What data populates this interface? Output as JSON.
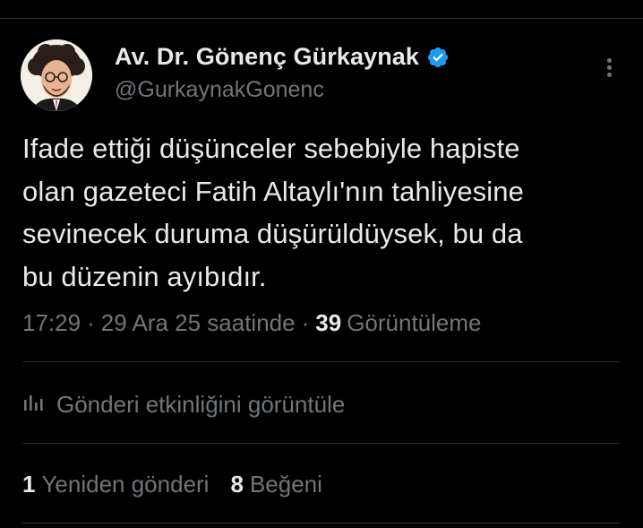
{
  "tweet": {
    "author": {
      "display_name": "Av. Dr. Gönenç Gürkaynak",
      "handle": "@GurkaynakGonenc",
      "verified_icon": "verified-badge-icon",
      "verified_color": "#1d9bf0"
    },
    "text": "Ifade ettiği düşünceler sebebiyle hapiste\nolan gazeteci Fatih Altaylı'nın tahliyesine\nsevinecek duruma düşürüldüysek, bu da\nbu düzenin ayıbıdır.",
    "time": "17:29",
    "separator": "·",
    "date": "29 Ara 25 saatinde",
    "views_count": "39",
    "views_label": "Görüntüleme",
    "activity_icon": "analytics-bar-icon",
    "activity_label": "Gönderi etkinliğini görüntüle",
    "reposts_count": "1",
    "reposts_label": "Yeniden gönderi",
    "likes_count": "8",
    "likes_label": "Beğeni"
  },
  "colors": {
    "background": "#000000",
    "text_primary": "#e7e9ea",
    "text_secondary": "#71767b",
    "divider": "#2f3336"
  }
}
